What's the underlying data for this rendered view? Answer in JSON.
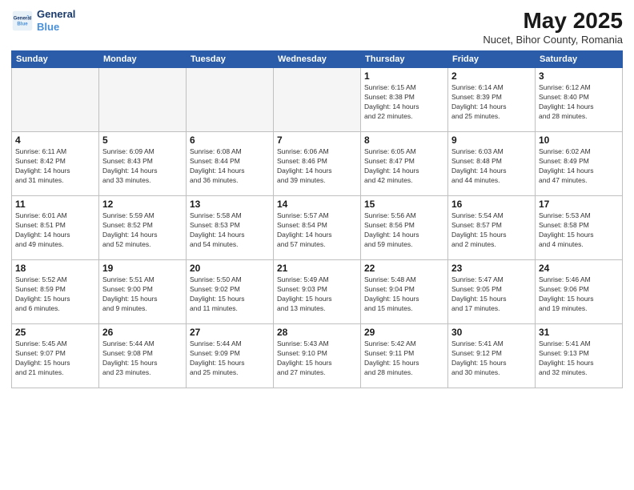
{
  "header": {
    "logo_line1": "General",
    "logo_line2": "Blue",
    "month_year": "May 2025",
    "location": "Nucet, Bihor County, Romania"
  },
  "weekdays": [
    "Sunday",
    "Monday",
    "Tuesday",
    "Wednesday",
    "Thursday",
    "Friday",
    "Saturday"
  ],
  "weeks": [
    [
      {
        "day": "",
        "info": ""
      },
      {
        "day": "",
        "info": ""
      },
      {
        "day": "",
        "info": ""
      },
      {
        "day": "",
        "info": ""
      },
      {
        "day": "1",
        "info": "Sunrise: 6:15 AM\nSunset: 8:38 PM\nDaylight: 14 hours\nand 22 minutes."
      },
      {
        "day": "2",
        "info": "Sunrise: 6:14 AM\nSunset: 8:39 PM\nDaylight: 14 hours\nand 25 minutes."
      },
      {
        "day": "3",
        "info": "Sunrise: 6:12 AM\nSunset: 8:40 PM\nDaylight: 14 hours\nand 28 minutes."
      }
    ],
    [
      {
        "day": "4",
        "info": "Sunrise: 6:11 AM\nSunset: 8:42 PM\nDaylight: 14 hours\nand 31 minutes."
      },
      {
        "day": "5",
        "info": "Sunrise: 6:09 AM\nSunset: 8:43 PM\nDaylight: 14 hours\nand 33 minutes."
      },
      {
        "day": "6",
        "info": "Sunrise: 6:08 AM\nSunset: 8:44 PM\nDaylight: 14 hours\nand 36 minutes."
      },
      {
        "day": "7",
        "info": "Sunrise: 6:06 AM\nSunset: 8:46 PM\nDaylight: 14 hours\nand 39 minutes."
      },
      {
        "day": "8",
        "info": "Sunrise: 6:05 AM\nSunset: 8:47 PM\nDaylight: 14 hours\nand 42 minutes."
      },
      {
        "day": "9",
        "info": "Sunrise: 6:03 AM\nSunset: 8:48 PM\nDaylight: 14 hours\nand 44 minutes."
      },
      {
        "day": "10",
        "info": "Sunrise: 6:02 AM\nSunset: 8:49 PM\nDaylight: 14 hours\nand 47 minutes."
      }
    ],
    [
      {
        "day": "11",
        "info": "Sunrise: 6:01 AM\nSunset: 8:51 PM\nDaylight: 14 hours\nand 49 minutes."
      },
      {
        "day": "12",
        "info": "Sunrise: 5:59 AM\nSunset: 8:52 PM\nDaylight: 14 hours\nand 52 minutes."
      },
      {
        "day": "13",
        "info": "Sunrise: 5:58 AM\nSunset: 8:53 PM\nDaylight: 14 hours\nand 54 minutes."
      },
      {
        "day": "14",
        "info": "Sunrise: 5:57 AM\nSunset: 8:54 PM\nDaylight: 14 hours\nand 57 minutes."
      },
      {
        "day": "15",
        "info": "Sunrise: 5:56 AM\nSunset: 8:56 PM\nDaylight: 14 hours\nand 59 minutes."
      },
      {
        "day": "16",
        "info": "Sunrise: 5:54 AM\nSunset: 8:57 PM\nDaylight: 15 hours\nand 2 minutes."
      },
      {
        "day": "17",
        "info": "Sunrise: 5:53 AM\nSunset: 8:58 PM\nDaylight: 15 hours\nand 4 minutes."
      }
    ],
    [
      {
        "day": "18",
        "info": "Sunrise: 5:52 AM\nSunset: 8:59 PM\nDaylight: 15 hours\nand 6 minutes."
      },
      {
        "day": "19",
        "info": "Sunrise: 5:51 AM\nSunset: 9:00 PM\nDaylight: 15 hours\nand 9 minutes."
      },
      {
        "day": "20",
        "info": "Sunrise: 5:50 AM\nSunset: 9:02 PM\nDaylight: 15 hours\nand 11 minutes."
      },
      {
        "day": "21",
        "info": "Sunrise: 5:49 AM\nSunset: 9:03 PM\nDaylight: 15 hours\nand 13 minutes."
      },
      {
        "day": "22",
        "info": "Sunrise: 5:48 AM\nSunset: 9:04 PM\nDaylight: 15 hours\nand 15 minutes."
      },
      {
        "day": "23",
        "info": "Sunrise: 5:47 AM\nSunset: 9:05 PM\nDaylight: 15 hours\nand 17 minutes."
      },
      {
        "day": "24",
        "info": "Sunrise: 5:46 AM\nSunset: 9:06 PM\nDaylight: 15 hours\nand 19 minutes."
      }
    ],
    [
      {
        "day": "25",
        "info": "Sunrise: 5:45 AM\nSunset: 9:07 PM\nDaylight: 15 hours\nand 21 minutes."
      },
      {
        "day": "26",
        "info": "Sunrise: 5:44 AM\nSunset: 9:08 PM\nDaylight: 15 hours\nand 23 minutes."
      },
      {
        "day": "27",
        "info": "Sunrise: 5:44 AM\nSunset: 9:09 PM\nDaylight: 15 hours\nand 25 minutes."
      },
      {
        "day": "28",
        "info": "Sunrise: 5:43 AM\nSunset: 9:10 PM\nDaylight: 15 hours\nand 27 minutes."
      },
      {
        "day": "29",
        "info": "Sunrise: 5:42 AM\nSunset: 9:11 PM\nDaylight: 15 hours\nand 28 minutes."
      },
      {
        "day": "30",
        "info": "Sunrise: 5:41 AM\nSunset: 9:12 PM\nDaylight: 15 hours\nand 30 minutes."
      },
      {
        "day": "31",
        "info": "Sunrise: 5:41 AM\nSunset: 9:13 PM\nDaylight: 15 hours\nand 32 minutes."
      }
    ]
  ]
}
